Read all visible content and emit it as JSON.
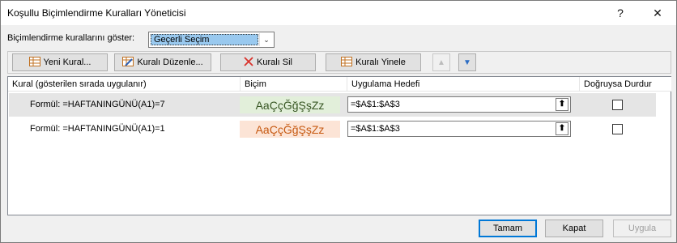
{
  "window": {
    "title": "Koşullu Biçimlendirme Kuralları Yöneticisi",
    "help_glyph": "?",
    "close_glyph": "✕"
  },
  "show_rules": {
    "label": "Biçimlendirme kurallarını göster:",
    "selected": "Geçerli Seçim",
    "arrow": "⌄"
  },
  "toolbar": {
    "new_rule": "Yeni Kural...",
    "edit_rule": "Kuralı Düzenle...",
    "delete_rule": "Kuralı Sil",
    "duplicate_rule": "Kuralı Yinele",
    "move_up": "▲",
    "move_down": "▼",
    "icons": {
      "new": "table-icon",
      "edit": "edit-table-icon",
      "delete": "x-icon",
      "duplicate": "table-icon"
    },
    "delete_color": "#d9312a"
  },
  "table": {
    "columns": [
      "Kural (gösterilen sırada uygulanır)",
      "Biçim",
      "Uygulama Hedefi",
      "Doğruysa Durdur"
    ],
    "rows": [
      {
        "rule": "Formül: =HAFTANINGÜNÜ(A1)=7",
        "preview": "AaÇçĞğŞşZz",
        "preview_bg": "#e2efda",
        "preview_fg": "#375623",
        "target": "=$A$1:$A$3",
        "stop": false,
        "selected": true
      },
      {
        "rule": "Formül: =HAFTANINGÜNÜ(A1)=1",
        "preview": "AaÇçĞğŞşZz",
        "preview_bg": "#fce4d6",
        "preview_fg": "#c65911",
        "target": "=$A$1:$A$3",
        "stop": false,
        "selected": false
      }
    ],
    "collapse_glyph": "⬆"
  },
  "footer": {
    "ok": "Tamam",
    "close": "Kapat",
    "apply": "Uygula"
  }
}
